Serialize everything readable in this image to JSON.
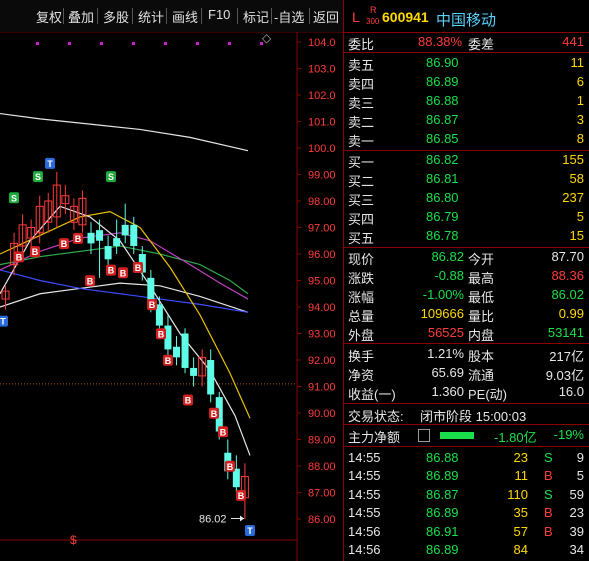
{
  "toolbar": {
    "items": [
      "复权",
      "叠加",
      "多股",
      "统计",
      "画线",
      "F10",
      "标记",
      "-自选",
      "返回"
    ]
  },
  "chart": {
    "price_axis": [
      "104.0",
      "103.0",
      "102.0",
      "101.0",
      "100.0",
      "99.00",
      "98.00",
      "97.00",
      "96.00",
      "95.00",
      "94.00",
      "93.00",
      "92.00",
      "91.00",
      "90.00",
      "89.00",
      "88.00",
      "87.00",
      "86.00"
    ],
    "low_label": "86.02",
    "marker_s": "S",
    "marker_b": "B",
    "marker_t": "T",
    "dollar": "$",
    "diamond": "◇",
    "candles": [
      {
        "o": 94.3,
        "c": 94.6,
        "h": 94.8,
        "l": 93.9
      },
      {
        "o": 95.6,
        "c": 96.4,
        "h": 96.8,
        "l": 95.2
      },
      {
        "o": 96.3,
        "c": 97.1,
        "h": 97.5,
        "l": 95.9
      },
      {
        "o": 96.6,
        "c": 97.0,
        "h": 97.3,
        "l": 96.2
      },
      {
        "o": 96.8,
        "c": 97.8,
        "h": 98.2,
        "l": 96.4
      },
      {
        "o": 97.2,
        "c": 98.0,
        "h": 98.3,
        "l": 96.8
      },
      {
        "o": 97.4,
        "c": 98.6,
        "h": 99.1,
        "l": 97.0
      },
      {
        "o": 97.9,
        "c": 98.2,
        "h": 98.6,
        "l": 97.5
      },
      {
        "o": 97.2,
        "c": 97.8,
        "h": 98.1,
        "l": 96.9
      },
      {
        "o": 97.1,
        "c": 98.1,
        "h": 98.4,
        "l": 96.8
      },
      {
        "o": 96.8,
        "c": 96.4,
        "h": 97.2,
        "l": 96.0
      },
      {
        "o": 96.9,
        "c": 96.5,
        "h": 97.3,
        "l": 95.1
      },
      {
        "o": 96.3,
        "c": 95.8,
        "h": 96.7,
        "l": 95.5
      },
      {
        "o": 96.6,
        "c": 96.3,
        "h": 97.3,
        "l": 96.0
      },
      {
        "o": 97.1,
        "c": 96.7,
        "h": 97.9,
        "l": 96.4
      },
      {
        "o": 97.1,
        "c": 96.3,
        "h": 97.4,
        "l": 96.0
      },
      {
        "o": 96.0,
        "c": 95.3,
        "h": 96.3,
        "l": 95.0
      },
      {
        "o": 95.1,
        "c": 94.0,
        "h": 95.4,
        "l": 93.8
      },
      {
        "o": 94.1,
        "c": 93.3,
        "h": 94.4,
        "l": 93.0
      },
      {
        "o": 93.3,
        "c": 92.4,
        "h": 93.7,
        "l": 92.1
      },
      {
        "o": 92.5,
        "c": 92.1,
        "h": 92.9,
        "l": 91.8
      },
      {
        "o": 93.0,
        "c": 91.7,
        "h": 93.2,
        "l": 91.5
      },
      {
        "o": 91.7,
        "c": 91.4,
        "h": 92.1,
        "l": 91.0
      },
      {
        "o": 91.4,
        "c": 92.1,
        "h": 92.4,
        "l": 91.0
      },
      {
        "o": 92.0,
        "c": 90.7,
        "h": 92.4,
        "l": 90.4
      },
      {
        "o": 90.6,
        "c": 89.3,
        "h": 90.8,
        "l": 89.0
      },
      {
        "o": 88.5,
        "c": 87.8,
        "h": 89.0,
        "l": 87.5
      },
      {
        "o": 87.9,
        "c": 87.2,
        "h": 88.4,
        "l": 87.0
      },
      {
        "o": 86.8,
        "c": 87.6,
        "h": 88.1,
        "l": 86.0
      }
    ]
  },
  "header": {
    "l": "L",
    "r": "R",
    "r_sub": "300",
    "code": "600941",
    "name": "中国移动"
  },
  "weibi": {
    "label": "委比",
    "value": "88.38%",
    "label2": "委差",
    "value2": "441"
  },
  "sell": [
    {
      "label": "卖五",
      "price": "86.90",
      "vol": "11"
    },
    {
      "label": "卖四",
      "price": "86.89",
      "vol": "6"
    },
    {
      "label": "卖三",
      "price": "86.88",
      "vol": "1"
    },
    {
      "label": "卖二",
      "price": "86.87",
      "vol": "3"
    },
    {
      "label": "卖一",
      "price": "86.85",
      "vol": "8"
    }
  ],
  "buy": [
    {
      "label": "买一",
      "price": "86.82",
      "vol": "155"
    },
    {
      "label": "买二",
      "price": "86.81",
      "vol": "58"
    },
    {
      "label": "买三",
      "price": "86.80",
      "vol": "237"
    },
    {
      "label": "买四",
      "price": "86.79",
      "vol": "5"
    },
    {
      "label": "买五",
      "price": "86.78",
      "vol": "15"
    }
  ],
  "quote": [
    {
      "l1": "现价",
      "v1": "86.82",
      "c1": "g",
      "l2": "今开",
      "v2": "87.70",
      "c2": "w"
    },
    {
      "l1": "涨跌",
      "v1": "-0.88",
      "c1": "g",
      "l2": "最高",
      "v2": "88.36",
      "c2": "r"
    },
    {
      "l1": "涨幅",
      "v1": "-1.00%",
      "c1": "g",
      "l2": "最低",
      "v2": "86.02",
      "c2": "g"
    },
    {
      "l1": "总量",
      "v1": "109666",
      "c1": "y",
      "l2": "量比",
      "v2": "0.99",
      "c2": "y"
    },
    {
      "l1": "外盘",
      "v1": "56525",
      "c1": "r",
      "l2": "内盘",
      "v2": "53141",
      "c2": "g"
    }
  ],
  "stats": [
    {
      "l1": "换手",
      "v1": "1.21%",
      "l2": "股本",
      "v2": "217亿"
    },
    {
      "l1": "净资",
      "v1": "65.69",
      "l2": "流通",
      "v2": "9.03亿"
    },
    {
      "l1": "收益(一)",
      "v1": "1.360",
      "l2": "PE(动)",
      "v2": "16.0"
    }
  ],
  "trade_status": {
    "label": "交易状态:",
    "value": "闭市阶段 15:00:03"
  },
  "main_flow": {
    "label": "主力净额",
    "value": "-1.80亿",
    "pct": "-19%"
  },
  "ticks": [
    {
      "time": "14:55",
      "price": "86.88",
      "vol": "23",
      "bs": "S",
      "n": "9"
    },
    {
      "time": "14:55",
      "price": "86.89",
      "vol": "11",
      "bs": "B",
      "n": "5"
    },
    {
      "time": "14:55",
      "price": "86.87",
      "vol": "110",
      "bs": "S",
      "n": "59"
    },
    {
      "time": "14:55",
      "price": "86.89",
      "vol": "35",
      "bs": "B",
      "n": "23"
    },
    {
      "time": "14:56",
      "price": "86.91",
      "vol": "57",
      "bs": "B",
      "n": "39"
    },
    {
      "time": "14:56",
      "price": "86.89",
      "vol": "84",
      "bs": "",
      "n": "34"
    }
  ],
  "colors": {
    "up": "#ff3b3b",
    "down": "#19e04a",
    "frame": "#8a0000",
    "cyan": "#5ad1ff"
  }
}
